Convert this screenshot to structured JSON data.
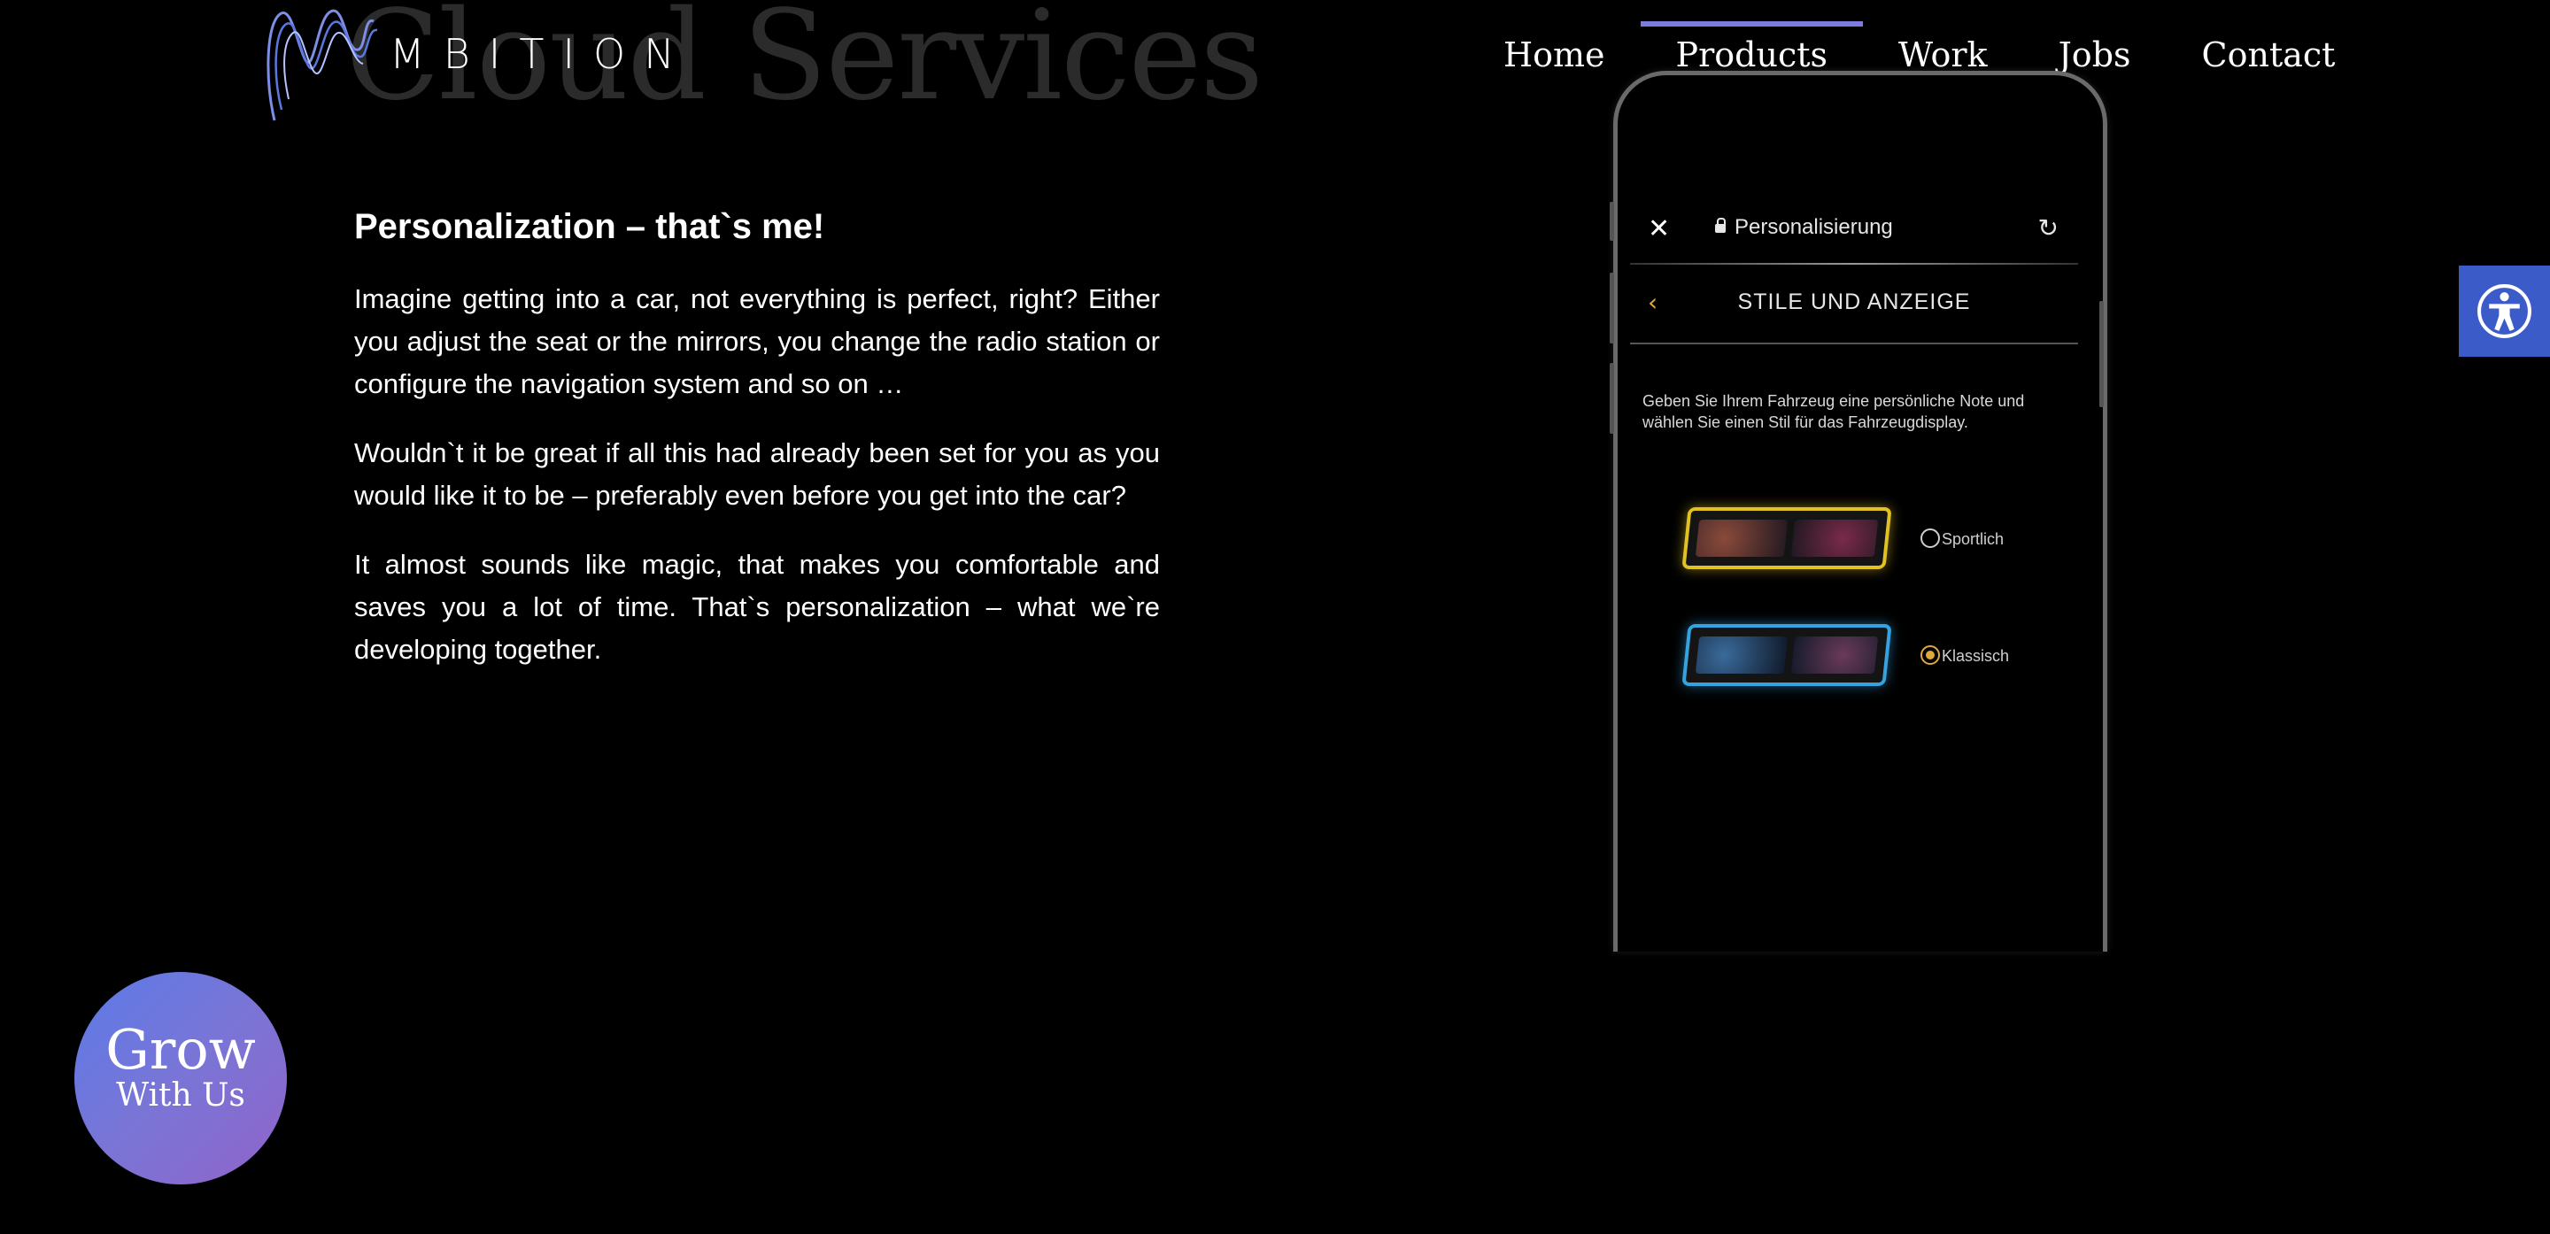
{
  "background_heading": "Cloud Services",
  "logo": {
    "text": "MBITION"
  },
  "nav": {
    "items": [
      {
        "label": "Home",
        "active": false
      },
      {
        "label": "Products",
        "active": true
      },
      {
        "label": "Work",
        "active": false
      },
      {
        "label": "Jobs",
        "active": false
      },
      {
        "label": "Contact",
        "active": false
      }
    ]
  },
  "content": {
    "heading": "Personalization – that`s me!",
    "paragraphs": [
      "Imagine getting into a car, not everything is perfect, right? Either you adjust the seat or the mirrors, you change the radio station or configure the navigation system and so on …",
      "Wouldn`t it be great if all this had already been set for you as you would like it to be – preferably even before you get into the car?",
      "It almost sounds like magic, that makes you comfortable and saves you a lot of time. That`s personalization – what we`re developing together."
    ]
  },
  "phone": {
    "browser_title": "Personalisierung",
    "page_title": "STILE UND ANZEIGE",
    "description": "Geben Sie Ihrem Fahrzeug eine persönliche Note und wählen Sie einen Stil für das Fahrzeugdisplay.",
    "options": [
      {
        "label": "Sportlich",
        "selected": false,
        "accent": "#e2c223"
      },
      {
        "label": "Klassisch",
        "selected": true,
        "accent": "#35a3e0"
      }
    ]
  },
  "grow_button": {
    "line1": "Grow",
    "line2": "With Us"
  },
  "colors": {
    "background": "#000000",
    "nav_active_indicator": "#7d7be0",
    "accessibility_button": "#3b5bc9",
    "grow_gradient_start": "#5b7ae8",
    "grow_gradient_end": "#9163c9",
    "phone_accent": "#e0a836"
  },
  "icons": {
    "logo": "wave-logo-icon",
    "accessibility": "accessibility-icon",
    "close": "close-icon",
    "lock": "lock-icon",
    "reload": "reload-icon",
    "back": "chevron-left-icon"
  }
}
